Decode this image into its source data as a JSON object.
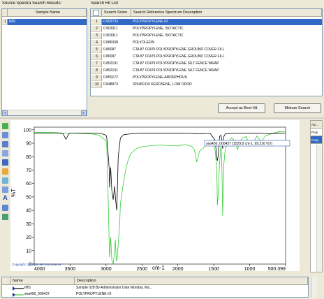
{
  "source_panel": {
    "title": "Source Spectra Search Results:",
    "column_header": "Sample Name",
    "rows": [
      {
        "index": "1",
        "name": "IMS"
      }
    ]
  },
  "hit_panel": {
    "title": "Search Hit List",
    "columns": [
      "Search Score",
      "Search Reference Spectrum Description"
    ],
    "rows": [
      {
        "index": "1",
        "score": "0.909733",
        "description": "POLYPROPYLENE #2"
      },
      {
        "index": "2",
        "score": "0.903311",
        "description": "POLYPROPYLENE, ISOTACTIC"
      },
      {
        "index": "3",
        "score": "0.903311",
        "description": "POLYPROPYLENE, ISOTACTIC"
      },
      {
        "index": "4",
        "score": "0.886338",
        "description": "POLYOLEFIN"
      },
      {
        "index": "5",
        "score": "0.86097",
        "description": "CTA 87 C0475 POLYPROPYLENE GROUND COVER FILL"
      },
      {
        "index": "6",
        "score": "0.86097",
        "description": "CTA 87 C0475 POLYPROPYLENE GROUND COVER FILL"
      },
      {
        "index": "7",
        "score": "0.852191",
        "description": "CTA 87 C0479 POLYPROPYLENE SILT FENCE WRAP"
      },
      {
        "index": "8",
        "score": "0.852191",
        "description": "CTA 87 C0479 POLYPROPYLENE SILT FENCE WRAP"
      },
      {
        "index": "9",
        "score": "0.850172",
        "description": "POLYPROPYLENE-AMORPHOUS"
      },
      {
        "index": "10",
        "score": "0.848973",
        "description": "329460.DX KEROSENE, LOW ODOR"
      }
    ],
    "accept_button": "Accept as Best Hit",
    "mixture_button": "Mixture Search"
  },
  "spectrum": {
    "tooltip": "sea450_000437 (1529.8 cm-1, 99.216 %T)",
    "copyright": "Copyright 1999 Nicolet Instruments"
  },
  "right_tabs": [
    "Ad...",
    "Prop",
    "Copy"
  ],
  "legend": {
    "columns": [
      "Name",
      "Description"
    ],
    "rows": [
      {
        "name": "IMS",
        "description": "Sample 028 By Administrator Date Monday, Ma...",
        "color": "#000000"
      },
      {
        "name": "sea450_000437",
        "description": "POLYPROPYLENE #2",
        "color": "#33cc33"
      }
    ]
  },
  "chart_data": {
    "type": "line",
    "xlabel": "cm-1",
    "ylabel": "%T",
    "x_tick_labels": [
      "4000",
      "3500",
      "3000",
      "2500",
      "2000",
      "1500",
      "1000",
      "500.399"
    ],
    "x_ticks": [
      4000,
      3500,
      3000,
      2500,
      2000,
      1500,
      1000,
      500.399
    ],
    "y_tick_labels": [
      "100",
      "90",
      "80",
      "70",
      "60",
      "50",
      "40",
      "30",
      "20",
      "10",
      "0"
    ],
    "y_ticks": [
      100,
      90,
      80,
      70,
      60,
      50,
      40,
      30,
      20,
      10,
      0
    ],
    "xlim": [
      4000,
      500
    ],
    "ylim": [
      0,
      102
    ],
    "grid": false,
    "series": [
      {
        "name": "IMS",
        "color": "#000000",
        "x": [
          4000,
          3750,
          3650,
          3600,
          3560,
          3520,
          3500,
          3200,
          3100,
          3050,
          3000,
          2990,
          2970,
          2955,
          2950,
          2935,
          2920,
          2900,
          2880,
          2870,
          2860,
          2850,
          2830,
          2800,
          2750,
          2600,
          2500,
          2000,
          1850,
          1750,
          1730,
          1700,
          1650,
          1600,
          1550,
          1480,
          1460,
          1450,
          1440,
          1420,
          1400,
          1390,
          1376,
          1360,
          1340,
          1300,
          1200,
          1000,
          900,
          800,
          720,
          700,
          600,
          500
        ],
        "y": [
          97.5,
          97.5,
          97.5,
          97.2,
          93,
          96.8,
          97.5,
          97.5,
          97.3,
          97,
          96,
          94,
          82,
          70,
          57,
          72,
          55,
          48,
          58,
          50,
          44,
          40,
          80,
          94,
          96.5,
          97.3,
          97.4,
          97.4,
          97.3,
          97.2,
          97.0,
          97.1,
          97.2,
          97.3,
          97.3,
          92,
          80,
          77,
          80,
          95,
          96,
          93,
          86,
          95,
          97,
          97.2,
          97.3,
          97.4,
          97.4,
          97.3,
          97.0,
          97.2,
          97.4,
          97.5
        ]
      },
      {
        "name": "sea450_000437",
        "color": "#33cc33",
        "x": [
          4000,
          3750,
          3650,
          3600,
          3500,
          3200,
          3100,
          3050,
          3000,
          2990,
          2970,
          2955,
          2950,
          2935,
          2920,
          2900,
          2880,
          2870,
          2860,
          2850,
          2830,
          2810,
          2800,
          2780,
          2760,
          2740,
          2720,
          2700,
          2680,
          2660,
          2640,
          2620,
          2600,
          2560,
          2500,
          2400,
          2300,
          2200,
          2100,
          2000,
          1950,
          1900,
          1850,
          1800,
          1770,
          1750,
          1740,
          1720,
          1700,
          1680,
          1650,
          1600,
          1550,
          1500,
          1480,
          1460,
          1455,
          1450,
          1440,
          1420,
          1400,
          1390,
          1376,
          1360,
          1340,
          1300,
          1250,
          1200,
          1168,
          1150,
          1100,
          1050,
          997,
          970,
          940,
          900,
          840,
          808,
          780,
          700,
          600,
          500
        ],
        "y": [
          98,
          98,
          97.8,
          97.5,
          97.5,
          97,
          96,
          94,
          92,
          88,
          50,
          12,
          5,
          20,
          3,
          0,
          10,
          18,
          5,
          2,
          15,
          30,
          45,
          52,
          60,
          66,
          72,
          76,
          79,
          82,
          83,
          84,
          85,
          86.5,
          87.5,
          88,
          88.5,
          88.5,
          88.2,
          88,
          88.6,
          89,
          88.3,
          87.5,
          85,
          80,
          76,
          79,
          84,
          85,
          86,
          89,
          92,
          90,
          84,
          72,
          60,
          44,
          50,
          75,
          88,
          80,
          36,
          74,
          86,
          90,
          94,
          91.5,
          85,
          90,
          94,
          95,
          88,
          91,
          91,
          95.5,
          91,
          93.5,
          95.5,
          97,
          98.5,
          99
        ]
      }
    ]
  }
}
